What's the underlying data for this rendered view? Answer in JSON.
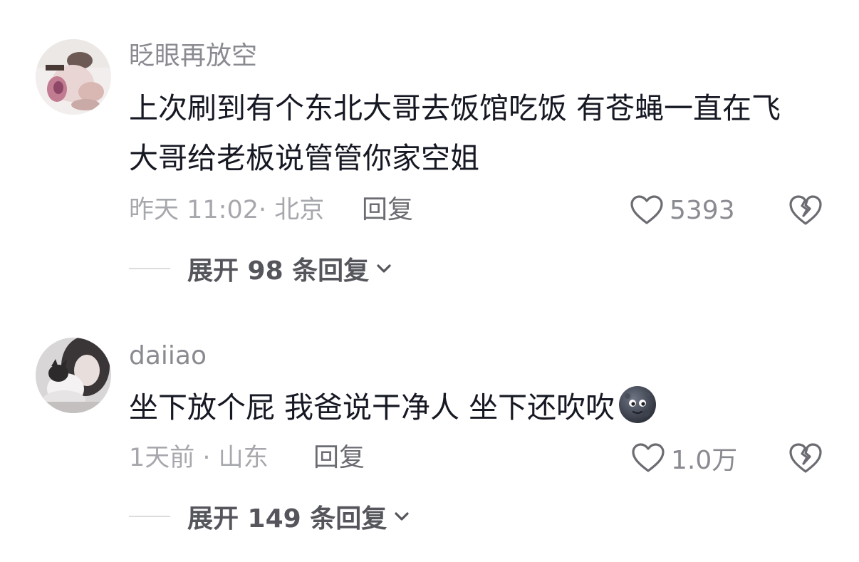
{
  "comments": [
    {
      "username": "眨眼再放空",
      "text": "上次刷到有个东北大哥去饭馆吃饭 有苍蝇一直在飞 大哥给老板说管管你家空姐",
      "emoji": "",
      "time_location": "昨天 11:02· 北京",
      "reply_label": "回复",
      "like_count": "5393",
      "expand_label": "展开 98 条回复"
    },
    {
      "username": "daiiao",
      "text": "坐下放个屁 我爸说干净人 坐下还吹吹",
      "emoji": "dark-moon-face-emoji",
      "time_location": "1天前 · 山东",
      "reply_label": "回复",
      "like_count": "1.0万",
      "expand_label": "展开 149 条回复"
    }
  ],
  "icons": {
    "like": "heart-outline-icon",
    "dislike": "broken-heart-icon",
    "expand": "chevron-down-icon"
  },
  "colors": {
    "username": "#8a8b91",
    "text": "#161823",
    "meta": "#a7a8ad",
    "icon": "#6b6c72"
  }
}
